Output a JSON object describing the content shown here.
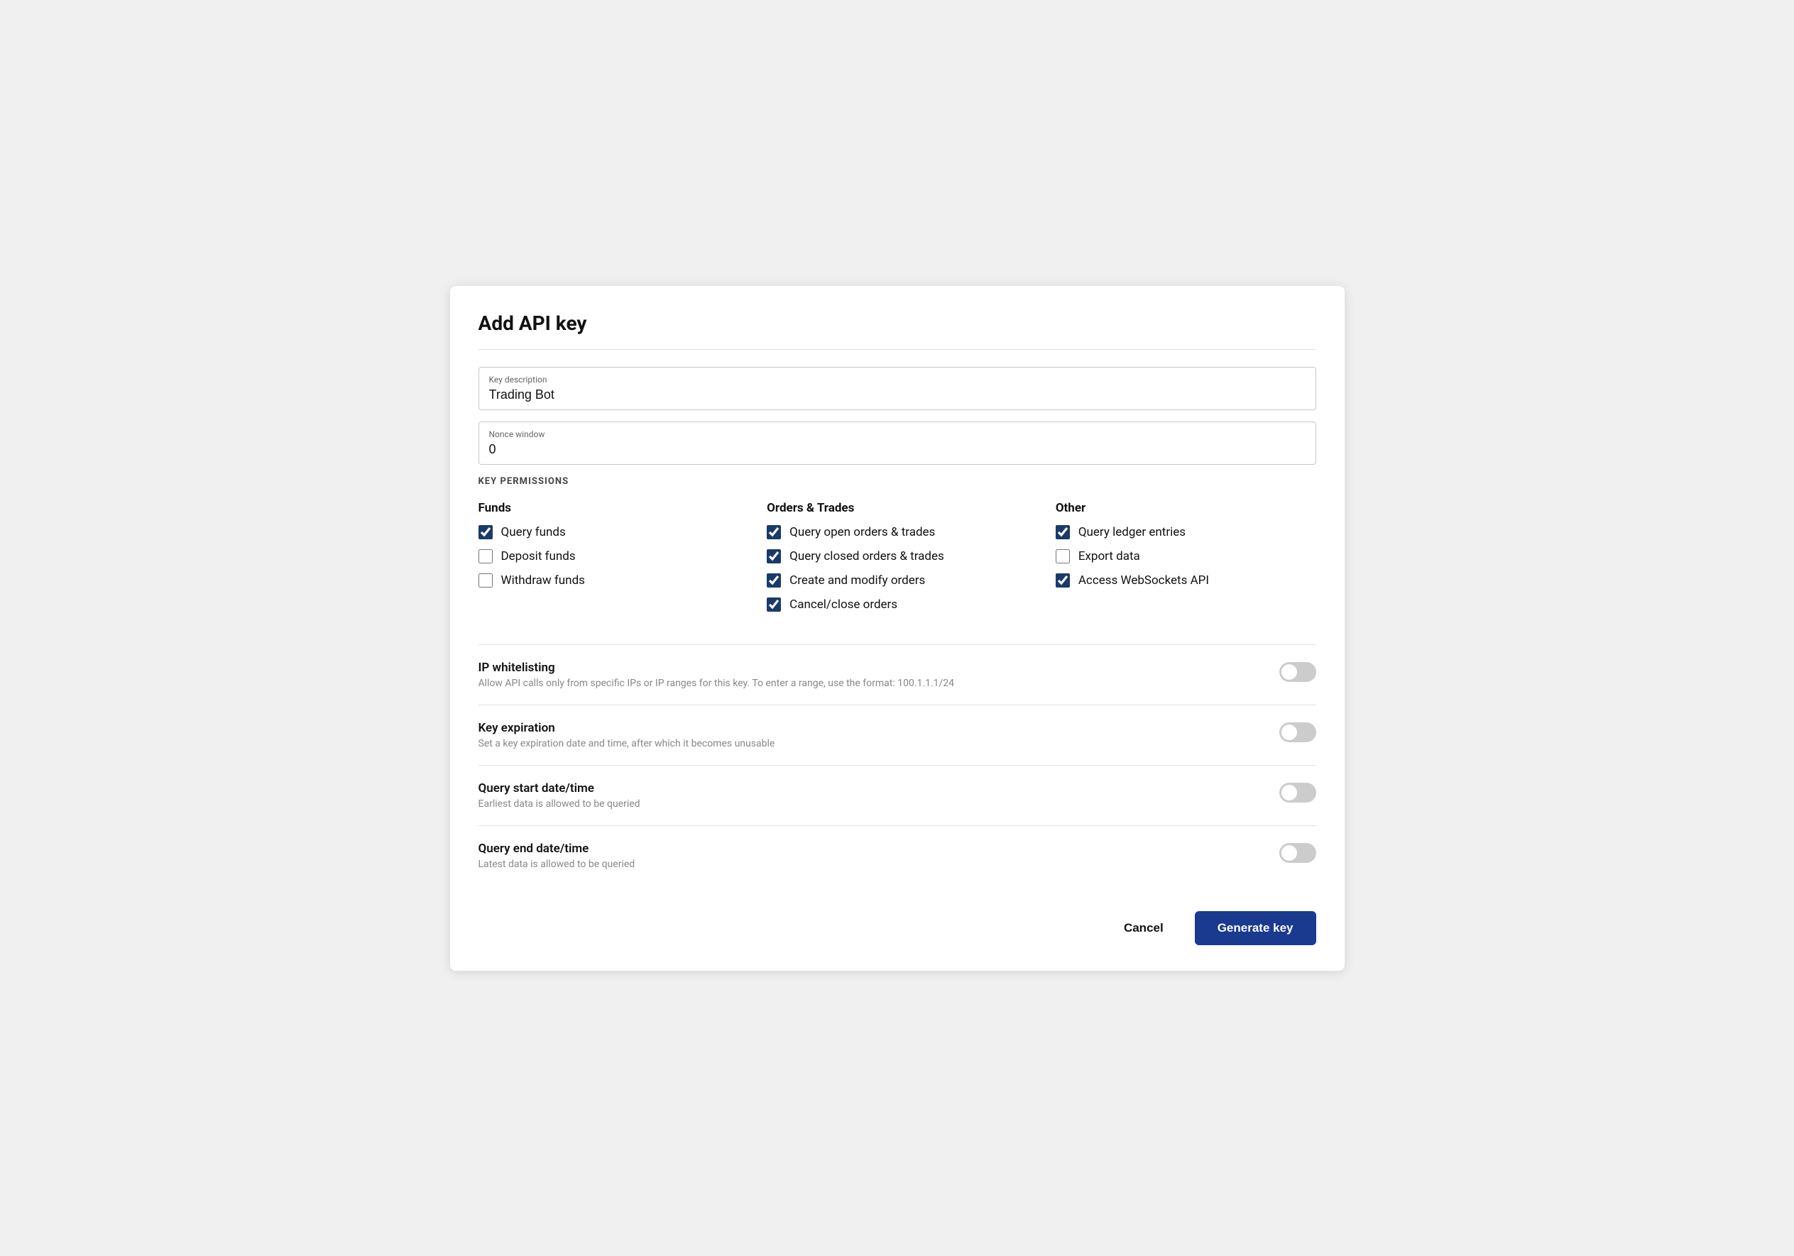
{
  "title": "Add API key",
  "fields": {
    "key_description": {
      "label": "Key description",
      "value": "Trading Bot"
    },
    "nonce_window": {
      "label": "Nonce window",
      "value": "0"
    }
  },
  "permissions_section_title": "KEY PERMISSIONS",
  "permissions": {
    "funds": {
      "heading": "Funds",
      "items": [
        {
          "label": "Query funds",
          "checked": true
        },
        {
          "label": "Deposit funds",
          "checked": false
        },
        {
          "label": "Withdraw funds",
          "checked": false
        }
      ]
    },
    "orders_trades": {
      "heading": "Orders & Trades",
      "items": [
        {
          "label": "Query open orders & trades",
          "checked": true
        },
        {
          "label": "Query closed orders & trades",
          "checked": true
        },
        {
          "label": "Create and modify orders",
          "checked": true
        },
        {
          "label": "Cancel/close orders",
          "checked": true
        }
      ]
    },
    "other": {
      "heading": "Other",
      "items": [
        {
          "label": "Query ledger entries",
          "checked": true
        },
        {
          "label": "Export data",
          "checked": false
        },
        {
          "label": "Access WebSockets API",
          "checked": true
        }
      ]
    }
  },
  "toggles": [
    {
      "title": "IP whitelisting",
      "description": "Allow API calls only from specific IPs or IP ranges for this key. To enter a range, use the format: 100.1.1.1/24",
      "enabled": false
    },
    {
      "title": "Key expiration",
      "description": "Set a key expiration date and time, after which it becomes unusable",
      "enabled": false
    },
    {
      "title": "Query start date/time",
      "description": "Earliest data is allowed to be queried",
      "enabled": false
    },
    {
      "title": "Query end date/time",
      "description": "Latest data is allowed to be queried",
      "enabled": false
    }
  ],
  "buttons": {
    "cancel": "Cancel",
    "generate": "Generate key"
  }
}
